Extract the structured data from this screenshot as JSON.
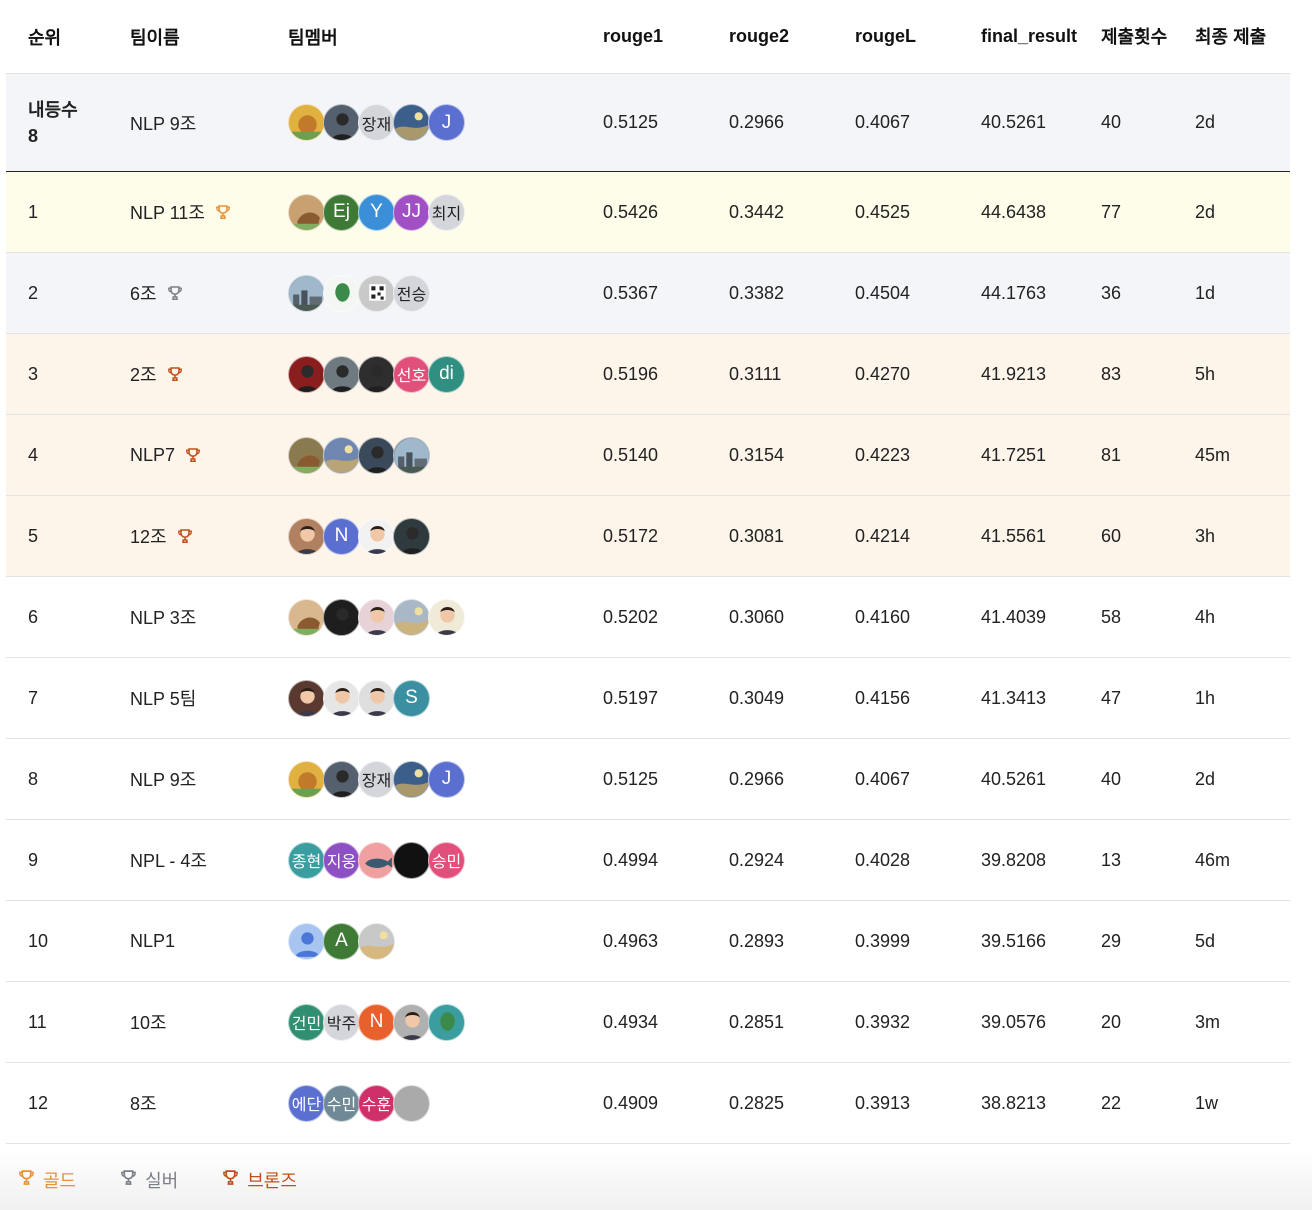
{
  "columns": {
    "rank": "순위",
    "team": "팀이름",
    "members": "팀멤버",
    "rouge1": "rouge1",
    "rouge2": "rouge2",
    "rougeL": "rougeL",
    "final": "final_result",
    "count": "제출횟수",
    "last": "최종 제출"
  },
  "my_rank": {
    "rank": "내등수 8",
    "team": "NLP 9조",
    "rouge1": "0.5125",
    "rouge2": "0.2966",
    "rougeL": "0.4067",
    "final": "40.5261",
    "count": "40",
    "last": "2d",
    "members": [
      {
        "label": "",
        "color": "#e0b040",
        "photo": "lion"
      },
      {
        "label": "",
        "color": "#55606e",
        "photo": "dark"
      },
      {
        "label": "장재",
        "color": "#d4d6db"
      },
      {
        "label": "",
        "color": "#3b5f8a",
        "photo": "art"
      },
      {
        "label": "J",
        "color": "#5a6fd0"
      }
    ]
  },
  "rows": [
    {
      "rank": "1",
      "team": "NLP 11조",
      "trophy": "gold",
      "rouge1": "0.5426",
      "rouge2": "0.3442",
      "rougeL": "0.4525",
      "final": "44.6438",
      "count": "77",
      "last": "2d",
      "members": [
        {
          "label": "",
          "color": "#c9a070",
          "photo": "dog"
        },
        {
          "label": "Ej",
          "color": "#3e7a35"
        },
        {
          "label": "Y",
          "color": "#3a8fd8"
        },
        {
          "label": "JJ",
          "color": "#a04fc4"
        },
        {
          "label": "최지",
          "color": "#d4d6db"
        }
      ]
    },
    {
      "rank": "2",
      "team": "6조",
      "trophy": "silver",
      "rouge1": "0.5367",
      "rouge2": "0.3382",
      "rougeL": "0.4504",
      "final": "44.1763",
      "count": "36",
      "last": "1d",
      "members": [
        {
          "label": "",
          "color": "#7f95a8",
          "photo": "city"
        },
        {
          "label": "",
          "color": "#f3f6f3",
          "photo": "logo"
        },
        {
          "label": "",
          "color": "#c9c9c9",
          "photo": "qr"
        },
        {
          "label": "전승",
          "color": "#d4d6db"
        }
      ]
    },
    {
      "rank": "3",
      "team": "2조",
      "trophy": "bronze",
      "rouge1": "0.5196",
      "rouge2": "0.3111",
      "rougeL": "0.4270",
      "final": "41.9213",
      "count": "83",
      "last": "5h",
      "members": [
        {
          "label": "",
          "color": "#8a1e1e",
          "photo": "dark"
        },
        {
          "label": "",
          "color": "#6f7a80",
          "photo": "dark"
        },
        {
          "label": "",
          "color": "#2e2e2e",
          "photo": "dark"
        },
        {
          "label": "선호",
          "color": "#e0507a"
        },
        {
          "label": "di",
          "color": "#2f8f80"
        }
      ]
    },
    {
      "rank": "4",
      "team": "NLP7",
      "trophy": "bronze",
      "rouge1": "0.5140",
      "rouge2": "0.3154",
      "rougeL": "0.4223",
      "final": "41.7251",
      "count": "81",
      "last": "45m",
      "members": [
        {
          "label": "",
          "color": "#8a7a50",
          "photo": "dog"
        },
        {
          "label": "",
          "color": "#6e86b0",
          "photo": "art"
        },
        {
          "label": "",
          "color": "#3a4a5a",
          "photo": "dark"
        },
        {
          "label": "",
          "color": "#55606e",
          "photo": "city"
        }
      ]
    },
    {
      "rank": "5",
      "team": "12조",
      "trophy": "bronze",
      "rouge1": "0.5172",
      "rouge2": "0.3081",
      "rougeL": "0.4214",
      "final": "41.5561",
      "count": "60",
      "last": "3h",
      "members": [
        {
          "label": "",
          "color": "#b08060",
          "photo": "face"
        },
        {
          "label": "N",
          "color": "#5a6fd0"
        },
        {
          "label": "",
          "color": "#f2f2f2",
          "photo": "face"
        },
        {
          "label": "",
          "color": "#2e3a3e",
          "photo": "dark"
        }
      ]
    },
    {
      "rank": "6",
      "team": "NLP 3조",
      "trophy": "",
      "rouge1": "0.5202",
      "rouge2": "0.3060",
      "rougeL": "0.4160",
      "final": "41.4039",
      "count": "58",
      "last": "4h",
      "members": [
        {
          "label": "",
          "color": "#d9b890",
          "photo": "dog"
        },
        {
          "label": "",
          "color": "#1e1e1e",
          "photo": "dark"
        },
        {
          "label": "",
          "color": "#e7d2d8",
          "photo": "face"
        },
        {
          "label": "",
          "color": "#a9b7c6",
          "photo": "art"
        },
        {
          "label": "",
          "color": "#f0ead8",
          "photo": "face"
        }
      ]
    },
    {
      "rank": "7",
      "team": "NLP 5팀",
      "trophy": "",
      "rouge1": "0.5197",
      "rouge2": "0.3049",
      "rougeL": "0.4156",
      "final": "41.3413",
      "count": "47",
      "last": "1h",
      "members": [
        {
          "label": "",
          "color": "#5a3a30",
          "photo": "face"
        },
        {
          "label": "",
          "color": "#e6e6e6",
          "photo": "face"
        },
        {
          "label": "",
          "color": "#dedede",
          "photo": "face"
        },
        {
          "label": "S",
          "color": "#3a8fa0"
        }
      ]
    },
    {
      "rank": "8",
      "team": "NLP 9조",
      "trophy": "",
      "rouge1": "0.5125",
      "rouge2": "0.2966",
      "rougeL": "0.4067",
      "final": "40.5261",
      "count": "40",
      "last": "2d",
      "members": [
        {
          "label": "",
          "color": "#e0b040",
          "photo": "lion"
        },
        {
          "label": "",
          "color": "#55606e",
          "photo": "dark"
        },
        {
          "label": "장재",
          "color": "#d4d6db"
        },
        {
          "label": "",
          "color": "#3b5f8a",
          "photo": "art"
        },
        {
          "label": "J",
          "color": "#5a6fd0"
        }
      ]
    },
    {
      "rank": "9",
      "team": "NPL - 4조",
      "trophy": "",
      "rouge1": "0.4994",
      "rouge2": "0.2924",
      "rougeL": "0.4028",
      "final": "39.8208",
      "count": "13",
      "last": "46m",
      "members": [
        {
          "label": "종현",
          "color": "#3a9ea0"
        },
        {
          "label": "지웅",
          "color": "#8c4fc4"
        },
        {
          "label": "",
          "color": "#f0a0a0",
          "photo": "whale"
        },
        {
          "label": "",
          "color": "#111111"
        },
        {
          "label": "승민",
          "color": "#e0507a"
        }
      ]
    },
    {
      "rank": "10",
      "team": "NLP1",
      "trophy": "",
      "rouge1": "0.4963",
      "rouge2": "0.2893",
      "rougeL": "0.3999",
      "final": "39.5166",
      "count": "29",
      "last": "5d",
      "members": [
        {
          "label": "",
          "color": "#a8c4f0",
          "photo": "person"
        },
        {
          "label": "A",
          "color": "#3e7a35"
        },
        {
          "label": "",
          "color": "#c8c8c8",
          "photo": "art"
        }
      ]
    },
    {
      "rank": "11",
      "team": "10조",
      "trophy": "",
      "rouge1": "0.4934",
      "rouge2": "0.2851",
      "rougeL": "0.3932",
      "final": "39.0576",
      "count": "20",
      "last": "3m",
      "members": [
        {
          "label": "건민",
          "color": "#2f8f70"
        },
        {
          "label": "박주",
          "color": "#d4d6db"
        },
        {
          "label": "N",
          "color": "#e8602c"
        },
        {
          "label": "",
          "color": "#b0b0b0",
          "photo": "face"
        },
        {
          "label": "",
          "color": "#3a9ea0",
          "photo": "logo"
        }
      ]
    },
    {
      "rank": "12",
      "team": "8조",
      "trophy": "",
      "rouge1": "0.4909",
      "rouge2": "0.2825",
      "rougeL": "0.3913",
      "final": "38.8213",
      "count": "22",
      "last": "1w",
      "members": [
        {
          "label": "에단",
          "color": "#5a6fd0"
        },
        {
          "label": "수민",
          "color": "#6f8a96"
        },
        {
          "label": "수훈",
          "color": "#d0306a"
        },
        {
          "label": "",
          "color": "#aaaaaa"
        }
      ]
    }
  ],
  "legend": {
    "gold": {
      "label": "골드",
      "color": "#e8913a"
    },
    "silver": {
      "label": "실버",
      "color": "#7a7f88"
    },
    "bronze": {
      "label": "브론즈",
      "color": "#c0501a"
    }
  },
  "trophy_colors": {
    "gold": "#e8913a",
    "silver": "#7a7f88",
    "bronze": "#c0501a"
  }
}
